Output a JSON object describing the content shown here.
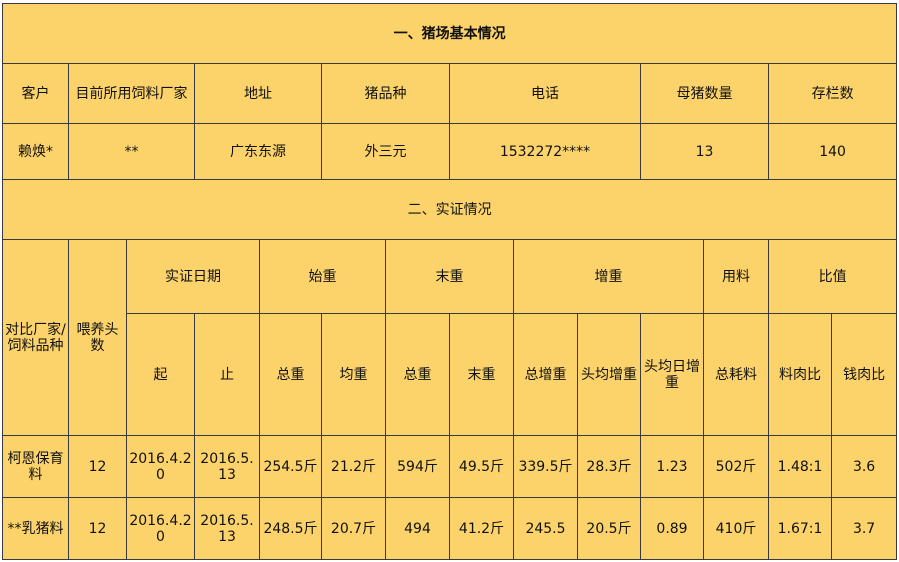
{
  "section1": {
    "title": "一、猪场基本情况",
    "headers": [
      "客户",
      "目前所用饲料厂家",
      "地址",
      "猪品种",
      "电话",
      "母猪数量",
      "存栏数"
    ],
    "row": [
      "赖焕*",
      "**",
      "广东东源",
      "外三元",
      "1532272****",
      "13",
      "140"
    ]
  },
  "section2": {
    "title": "二、实证情况",
    "headers": {
      "compare": "对比厂家/饲料品种",
      "heads": "喂养头数",
      "date": "实证日期",
      "start_weight": "始重",
      "end_weight": "末重",
      "gain": "增重",
      "feed": "用料",
      "ratio": "比值"
    },
    "subheaders": [
      "起",
      "止",
      "总重",
      "均重",
      "总重",
      "末重",
      "总增重",
      "头均增重",
      "头均日增重",
      "总耗料",
      "料肉比",
      "钱肉比"
    ],
    "rows": [
      [
        "柯恩保育料",
        "12",
        "2016.4.20",
        "2016.5.13",
        "254.5斤",
        "21.2斤",
        "594斤",
        "49.5斤",
        "339.5斤",
        "28.3斤",
        "1.23",
        "502斤",
        "1.48:1",
        "3.6"
      ],
      [
        "**乳猪料",
        "12",
        "2016.4.20",
        "2016.5.13",
        "248.5斤",
        "20.7斤",
        "494",
        "41.2斤",
        "245.5",
        "20.5斤",
        "0.89",
        "410斤",
        "1.67:1",
        "3.7"
      ]
    ]
  }
}
